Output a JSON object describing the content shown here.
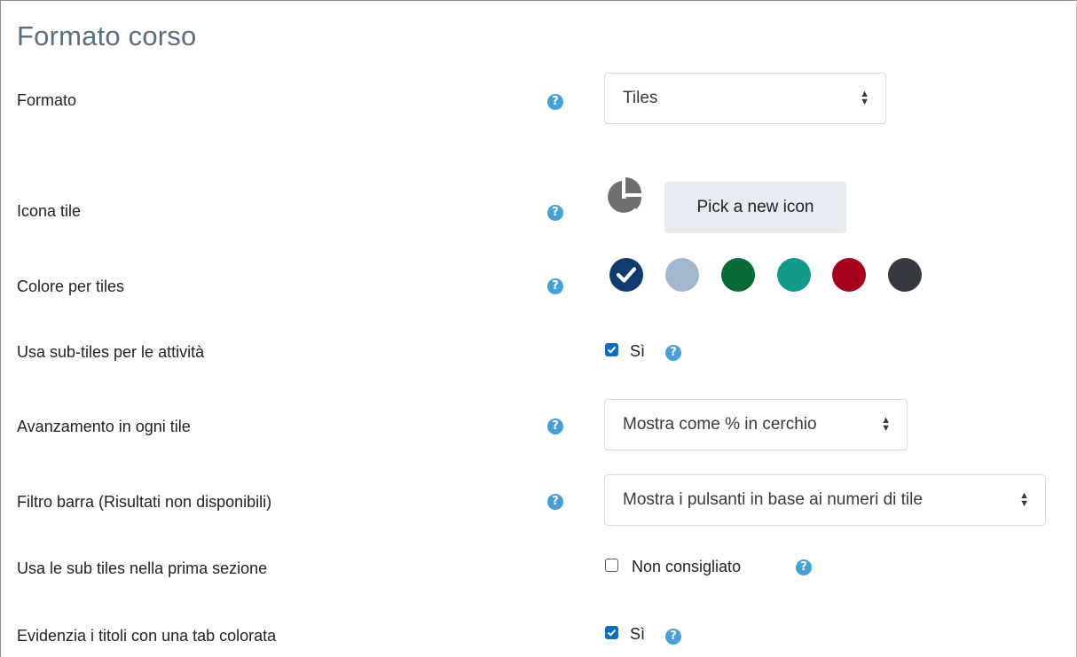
{
  "section_title": "Formato corso",
  "fields": {
    "formato": {
      "label": "Formato",
      "value": "Tiles"
    },
    "icona_tile": {
      "label": "Icona tile",
      "icon": "pie-chart-icon",
      "button_label": "Pick a new icon"
    },
    "colore": {
      "label": "Colore per tiles",
      "swatches": [
        "#0f3b6e",
        "#a1b6cf",
        "#0b6b36",
        "#139a8c",
        "#a5001c",
        "#36393d"
      ],
      "selected_index": 0
    },
    "sub_tiles": {
      "label": "Usa sub-tiles per le attività",
      "checkbox_label": "Sì",
      "checked": true
    },
    "avanzamento": {
      "label": "Avanzamento in ogni tile",
      "value": "Mostra come % in cerchio"
    },
    "filtro": {
      "label": "Filtro barra (Risultati non disponibili)",
      "value": "Mostra i pulsanti in base ai numeri di tile"
    },
    "sub_tiles_prima": {
      "label": "Usa le sub tiles nella prima sezione",
      "checkbox_label": "Non consigliato",
      "checked": false
    },
    "evidenzia": {
      "label": "Evidenzia i titoli con una tab colorata",
      "checkbox_label": "Sì",
      "checked": true
    }
  },
  "help_icon": "question-circle-icon",
  "colors": {
    "accent": "#0f6cbf",
    "help": "#46a0d7",
    "title": "#5a6e80"
  }
}
